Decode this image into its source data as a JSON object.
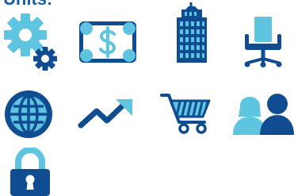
{
  "header": {
    "title": "Units:"
  },
  "colors": {
    "primary": "#0f4c92",
    "accent": "#5ec4e0",
    "title": "#1a5fa6"
  },
  "icons": [
    "gears-icon",
    "money-icon",
    "building-icon",
    "chair-icon",
    "globe-icon",
    "trend-icon",
    "cart-icon",
    "people-icon",
    "lock-icon"
  ]
}
